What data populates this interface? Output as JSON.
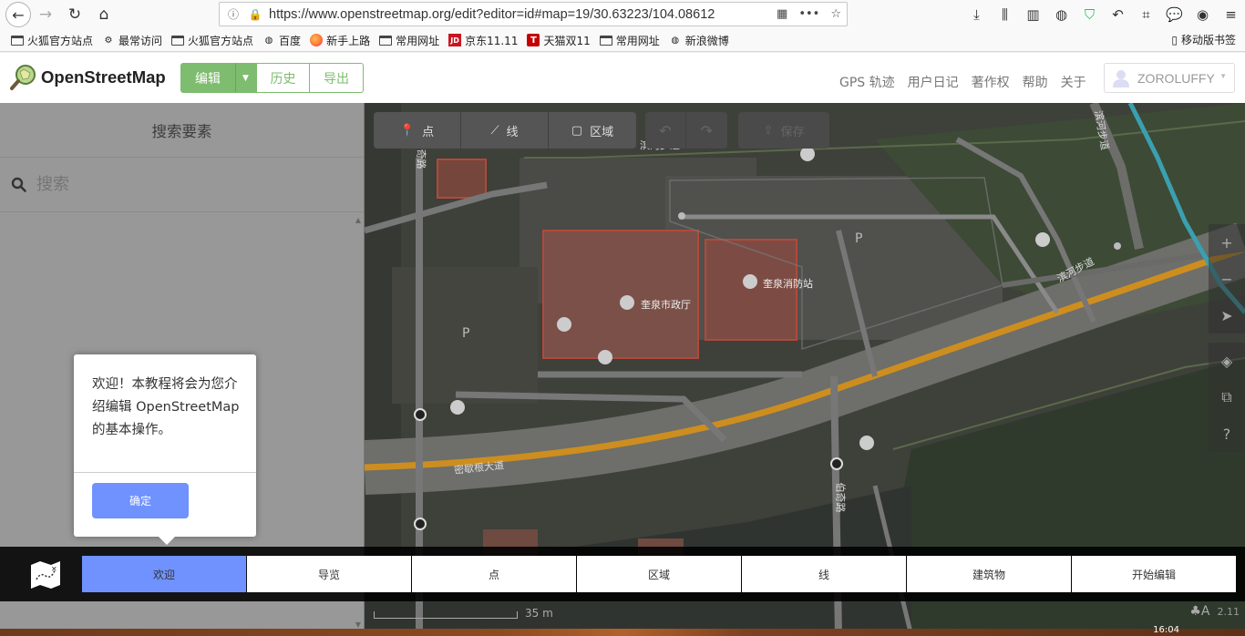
{
  "browser": {
    "url": "https://www.openstreetmap.org/edit?editor=id#map=19/30.63223/104.08612",
    "bookmarks": [
      {
        "label": "火狐官方站点",
        "icon": "folder-icon"
      },
      {
        "label": "最常访问",
        "icon": "gear-icon"
      },
      {
        "label": "火狐官方站点",
        "icon": "folder-icon"
      },
      {
        "label": "百度",
        "icon": "globe-icon"
      },
      {
        "label": "新手上路",
        "icon": "firefox-icon"
      },
      {
        "label": "常用网址",
        "icon": "folder-icon"
      },
      {
        "label": "京东11.11",
        "icon": "jd-icon"
      },
      {
        "label": "天猫双11",
        "icon": "tmall-icon"
      },
      {
        "label": "常用网址",
        "icon": "folder-icon"
      },
      {
        "label": "新浪微博",
        "icon": "globe-icon"
      }
    ],
    "jd_icon_text": "JD",
    "tmall_icon_text": "T",
    "mobile_bookmarks": "移动版书签"
  },
  "osm": {
    "brand": "OpenStreetMap",
    "edit_label": "编辑",
    "history_label": "历史",
    "export_label": "导出",
    "links": [
      "GPS 轨迹",
      "用户日记",
      "著作权",
      "帮助",
      "关于"
    ],
    "username": "ZOROLUFFY"
  },
  "sidebar": {
    "title": "搜索要素",
    "search_placeholder": "搜索"
  },
  "map": {
    "modes": [
      {
        "label": "点",
        "icon": "point-icon"
      },
      {
        "label": "线",
        "icon": "line-icon"
      },
      {
        "label": "区域",
        "icon": "area-icon"
      }
    ],
    "save_label": "保存",
    "labels": {
      "road_main": "密歇根大道",
      "road_river": "滨河步道",
      "road_river2": "滨河步道",
      "road_side": "滨河步道",
      "road_south": "伯奇路",
      "road_north": "伯奇路",
      "city_hall": "奎泉市政厅",
      "fire_station": "奎泉消防站",
      "parking": "P",
      "parking2": "P"
    },
    "scale_label": "35 m",
    "version": "2.11"
  },
  "walkthrough": {
    "popup_text": "欢迎！本教程将会为您介绍编辑 OpenStreetMap 的基本操作。",
    "ok_label": "确定",
    "steps": [
      "欢迎",
      "导览",
      "点",
      "区域",
      "线",
      "建筑物",
      "开始编辑"
    ],
    "active_step": 0
  },
  "taskbar": {
    "clock": "16:04"
  }
}
